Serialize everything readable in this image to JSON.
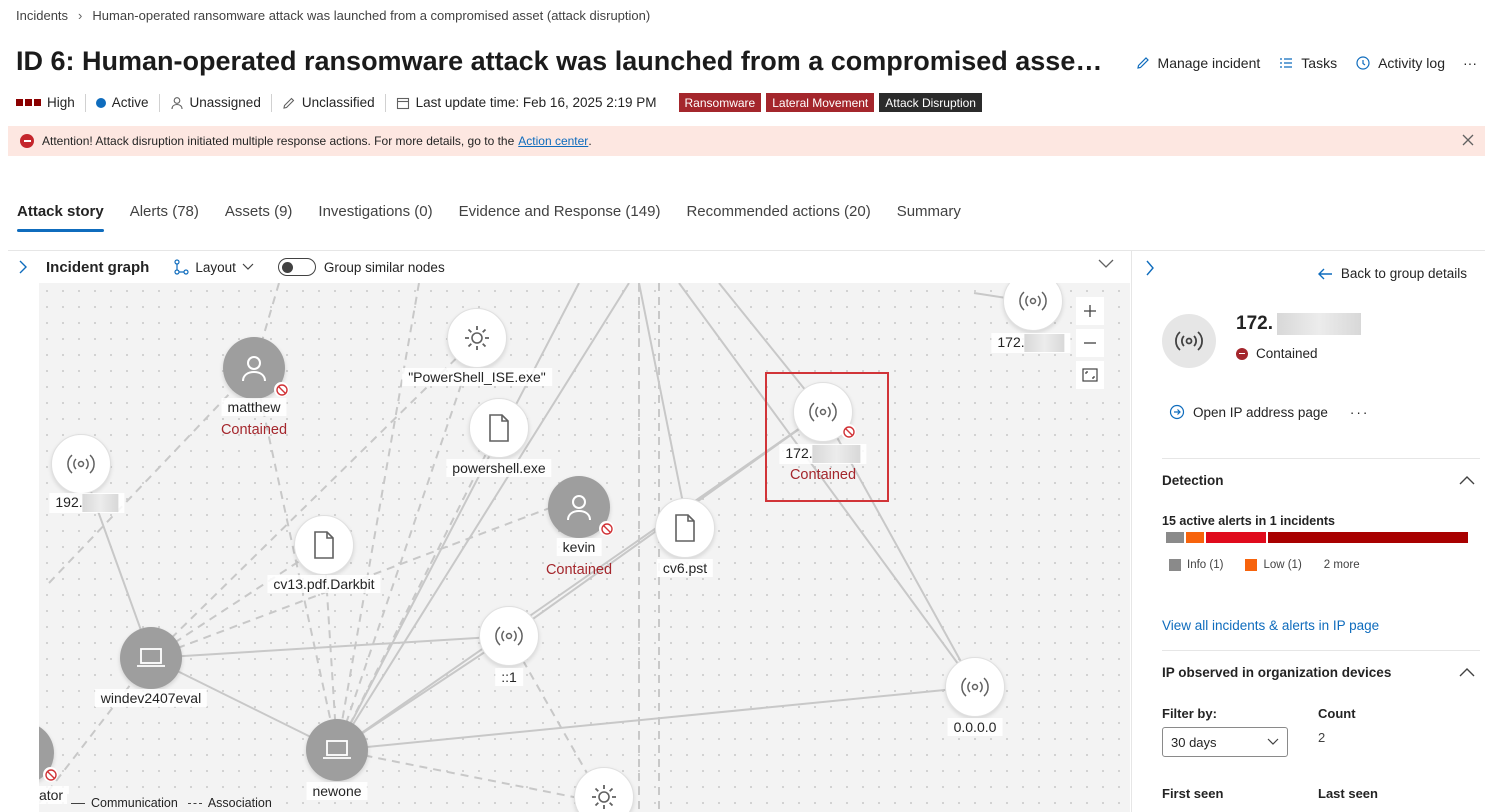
{
  "breadcrumb": {
    "root": "Incidents",
    "current": "Human-operated ransomware attack was launched from a compromised asset (attack disruption)"
  },
  "title": "ID 6: Human-operated ransomware attack was launched from a compromised asse…",
  "actions": {
    "manage": "Manage incident",
    "tasks": "Tasks",
    "activity": "Activity log",
    "more": "···"
  },
  "meta": {
    "severity": "High",
    "status": "Active",
    "assignee": "Unassigned",
    "classification": "Unclassified",
    "last_update": "Last update time: Feb 16, 2025 2:19 PM"
  },
  "tags": [
    "Ransomware",
    "Lateral Movement",
    "Attack Disruption"
  ],
  "banner": {
    "text": "Attention! Attack disruption initiated multiple response actions. For more details, go to the",
    "link": "Action center",
    "period": "."
  },
  "tabs": [
    {
      "label": "Attack story",
      "active": true
    },
    {
      "label": "Alerts (78)"
    },
    {
      "label": "Assets (9)"
    },
    {
      "label": "Investigations (0)"
    },
    {
      "label": "Evidence and Response (149)"
    },
    {
      "label": "Recommended actions (20)"
    },
    {
      "label": "Summary"
    }
  ],
  "graph": {
    "title": "Incident graph",
    "layout_label": "Layout",
    "group_label": "Group similar nodes",
    "nodes": {
      "matthew": "matthew",
      "matthew_status": "Contained",
      "powershell_ise": "\"PowerShell_ISE.exe\"",
      "powershell": "powershell.exe",
      "ip_192": "192.",
      "kevin": "kevin",
      "kevin_status": "Contained",
      "cv6": "cv6.pst",
      "ip_172_sel": "172.",
      "ip_172_sel_status": "Contained",
      "ip_172_top": "172.",
      "cv13": "cv13.pdf.Darkbit",
      "windev": "windev2407eval",
      "loopback": "::1",
      "zeros": "0.0.0.0",
      "newone": "newone",
      "ator": "ator"
    },
    "legend": {
      "communication": "Communication",
      "association": "Association"
    }
  },
  "side": {
    "back": "Back to group details",
    "ip": "172.",
    "status": "Contained",
    "open_ip": "Open IP address page",
    "more": "···",
    "detection_title": "Detection",
    "alerts_summary": "15 active alerts in 1 incidents",
    "legend_info": "Info (1)",
    "legend_low": "Low (1)",
    "legend_more": "2 more",
    "view_all": "View all incidents & alerts in IP page",
    "observed_title": "IP observed in organization devices",
    "filter_label": "Filter by:",
    "filter_value": "30 days",
    "count_label": "Count",
    "count_value": "2",
    "first_seen": "First seen",
    "last_seen": "Last seen"
  },
  "colors": {
    "accent": "#0f6cbd",
    "contained": "#a4262c",
    "severity": "#8b0000",
    "banner": "#fde7e1"
  }
}
